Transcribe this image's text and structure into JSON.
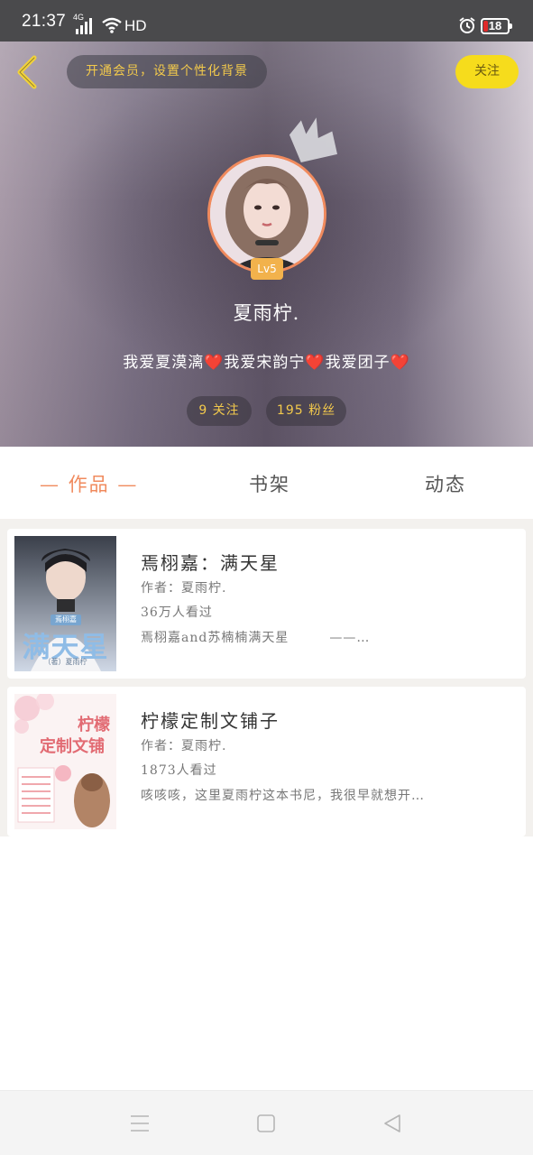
{
  "status_bar": {
    "time": "21:37",
    "network": "4G",
    "hd_label": "HD",
    "battery_level": "18",
    "battery_color": "#e02a2a"
  },
  "header": {
    "back_icon": "chevron-left-icon",
    "vip_label": "开通会员，设置个性化背景",
    "follow_label": "关注",
    "level": "Lv5",
    "nickname": "夏雨柠.",
    "bio_parts": [
      "我爱夏漠漓",
      "我爱宋韵宁",
      "我爱团子"
    ],
    "bio_heart": "❤️",
    "following_label": "9 关注",
    "followers_label": "195 粉丝",
    "accent_color": "#f2c94c"
  },
  "tabs": {
    "works": "— 作品 —",
    "bookshelf": "书架",
    "activity": "动态",
    "active_color": "#f08a5d"
  },
  "works": [
    {
      "title": "焉栩嘉：满天星",
      "author": "作者：夏雨柠.",
      "views": "36万人看过",
      "summary": "焉栩嘉and苏楠楠满天星　　　——…",
      "cover_title": "满天星",
      "cover_tag": "焉栩嘉",
      "cover_author": "（著）夏雨柠"
    },
    {
      "title": "柠檬定制文铺子",
      "author": "作者：夏雨柠.",
      "views": "1873人看过",
      "summary": "咳咳咳，这里夏雨柠这本书尼，我很早就想开…",
      "cover_title": "柠檬",
      "cover_subtitle": "定制文铺"
    }
  ],
  "nav": {
    "menu_icon": "menu-icon",
    "home_icon": "home-square-icon",
    "back_icon": "back-triangle-icon"
  }
}
